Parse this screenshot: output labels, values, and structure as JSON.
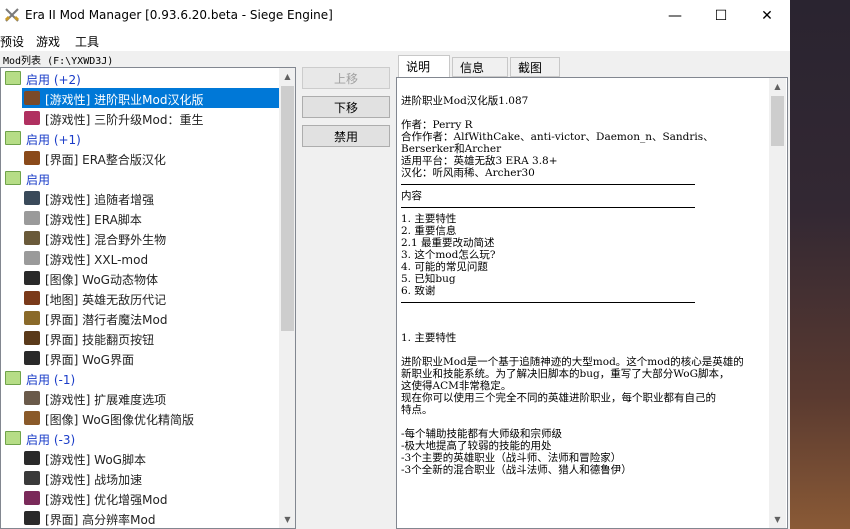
{
  "window": {
    "title": "Era II Mod Manager [0.93.6.20.beta - Siege Engine]",
    "controls": {
      "minimize": "—",
      "maximize": "☐",
      "close": "✕"
    }
  },
  "menu": [
    "预设",
    "游戏",
    "工具"
  ],
  "mod_path": "Mod列表 (F:\\YXWD3J)",
  "mod_list": [
    {
      "kind": "group",
      "label": "启用 (+2)"
    },
    {
      "kind": "item",
      "label": "[游戏性] 进阶职业Mod汉化版",
      "selected": true,
      "icon_color": "#7a4a2a"
    },
    {
      "kind": "item",
      "label": "[游戏性] 三阶升级Mod：重生",
      "icon_color": "#b03060"
    },
    {
      "kind": "group",
      "label": "启用 (+1)"
    },
    {
      "kind": "item",
      "label": "[界面] ERA整合版汉化",
      "icon_color": "#8a4a1a"
    },
    {
      "kind": "group",
      "label": "启用"
    },
    {
      "kind": "item",
      "label": "[游戏性] 追随者增强",
      "icon_color": "#3a4a5a"
    },
    {
      "kind": "item",
      "label": "[游戏性] ERA脚本",
      "icon_color": "#9a9a9a"
    },
    {
      "kind": "item",
      "label": "[游戏性] 混合野外生物",
      "icon_color": "#6a5a3a"
    },
    {
      "kind": "item",
      "label": "[游戏性] XXL-mod",
      "icon_color": "#9a9a9a"
    },
    {
      "kind": "item",
      "label": "[图像] WoG动态物体",
      "icon_color": "#2a2a2a"
    },
    {
      "kind": "item",
      "label": "[地图] 英雄无敌历代记",
      "icon_color": "#7a3a1a"
    },
    {
      "kind": "item",
      "label": "[界面] 潜行者魔法Mod",
      "icon_color": "#8a6a2a"
    },
    {
      "kind": "item",
      "label": "[界面] 技能翻页按钮",
      "icon_color": "#5a3a1a"
    },
    {
      "kind": "item",
      "label": "[界面] WoG界面",
      "icon_color": "#2a2a2a"
    },
    {
      "kind": "group",
      "label": "启用 (-1)"
    },
    {
      "kind": "item",
      "label": "[游戏性] 扩展难度选项",
      "icon_color": "#6a5a4a"
    },
    {
      "kind": "item",
      "label": "[图像] WoG图像优化精简版",
      "icon_color": "#8a5a2a"
    },
    {
      "kind": "group",
      "label": "启用 (-3)"
    },
    {
      "kind": "item",
      "label": "[游戏性] WoG脚本",
      "icon_color": "#2a2a2a"
    },
    {
      "kind": "item",
      "label": "[游戏性] 战场加速",
      "icon_color": "#3a3a3a"
    },
    {
      "kind": "item",
      "label": "[游戏性] 优化增强Mod",
      "icon_color": "#7a2a5a"
    },
    {
      "kind": "item",
      "label": "[界面] 高分辨率Mod",
      "icon_color": "#2a2a2a"
    }
  ],
  "buttons": {
    "up": "上移",
    "down": "下移",
    "disable": "禁用"
  },
  "tabs": [
    "说明",
    "信息",
    "截图"
  ],
  "description": [
    {
      "t": "line",
      "text": "进阶职业Mod汉化版1.087"
    },
    {
      "t": "gap"
    },
    {
      "t": "line",
      "text": "作者：Perry R"
    },
    {
      "t": "line",
      "text": "合作作者：AlfWithCake、anti-victor、Daemon_n、Sandris、"
    },
    {
      "t": "line",
      "text": "Berserker和Archer"
    },
    {
      "t": "line",
      "text": "适用平台：英雄无敌3 ERA 3.8+"
    },
    {
      "t": "line",
      "text": "汉化：听风雨稀、Archer30"
    },
    {
      "t": "rule"
    },
    {
      "t": "line",
      "text": " 内容"
    },
    {
      "t": "rule"
    },
    {
      "t": "line",
      "text": "1. 主要特性"
    },
    {
      "t": "line",
      "text": "2. 重要信息"
    },
    {
      "t": "line",
      "text": "2.1 最重要改动简述"
    },
    {
      "t": "line",
      "text": "3. 这个mod怎么玩?"
    },
    {
      "t": "line",
      "text": "4. 可能的常见问题"
    },
    {
      "t": "line",
      "text": "5. 已知bug"
    },
    {
      "t": "line",
      "text": "6. 致谢"
    },
    {
      "t": "rule"
    },
    {
      "t": "gap"
    },
    {
      "t": "gap"
    },
    {
      "t": "line",
      "text": "1. 主要特性"
    },
    {
      "t": "gap"
    },
    {
      "t": "line",
      "text": "进阶职业Mod是一个基于追随神迹的大型mod。这个mod的核心是英雄的"
    },
    {
      "t": "line",
      "text": "新职业和技能系统。为了解决旧脚本的bug，重写了大部分WoG脚本，"
    },
    {
      "t": "line",
      "text": "这使得ACM非常稳定。"
    },
    {
      "t": "line",
      "text": "现在你可以使用三个完全不同的英雄进阶职业，每个职业都有自己的"
    },
    {
      "t": "line",
      "text": "特点。"
    },
    {
      "t": "gap"
    },
    {
      "t": "line",
      "text": "-每个辅助技能都有大师级和宗师级"
    },
    {
      "t": "line",
      "text": "-极大地提高了较弱的技能的用处"
    },
    {
      "t": "line",
      "text": "-3个主要的英雄职业（战斗师、法师和冒险家）"
    },
    {
      "t": "line",
      "text": "-3个全新的混合职业（战斗法师、猎人和德鲁伊）"
    }
  ]
}
